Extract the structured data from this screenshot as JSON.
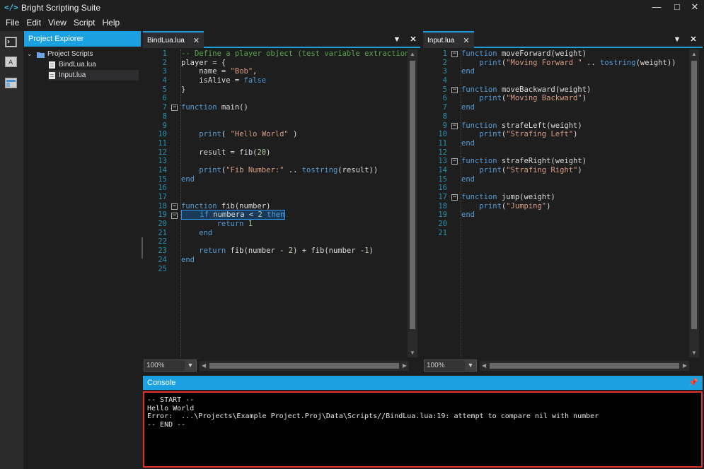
{
  "window": {
    "title": "Bright Scripting Suite",
    "icon": "code-brackets-icon",
    "controls": [
      "minimize",
      "maximize",
      "close"
    ]
  },
  "menu": [
    "File",
    "Edit",
    "View",
    "Script",
    "Help"
  ],
  "toolstrip": [
    "console-tool-icon",
    "text-tool-icon",
    "layout-tool-icon"
  ],
  "explorer": {
    "title": "Project Explorer",
    "folder": "Project Scripts",
    "files": [
      "BindLua.lua",
      "Input.lua"
    ]
  },
  "left_editor": {
    "tab": "BindLua.lua",
    "zoom": "100%",
    "line_numbers": [
      "1",
      "2",
      "3",
      "4",
      "5",
      "6",
      "7",
      "8",
      "9",
      "10",
      "11",
      "12",
      "13",
      "14",
      "15",
      "16",
      "17",
      "18",
      "19",
      "20",
      "21",
      "22",
      "23",
      "24",
      "25"
    ],
    "lines": [
      [
        [
          "cm",
          "-- Define a player object (test variable extraction)"
        ]
      ],
      [
        [
          "",
          "player = {"
        ]
      ],
      [
        [
          "",
          "    name = "
        ],
        [
          "str",
          "\"Bob\""
        ],
        [
          "",
          ","
        ]
      ],
      [
        [
          "",
          "    isAlive = "
        ],
        [
          "kw",
          "false"
        ]
      ],
      [
        [
          "",
          "}"
        ]
      ],
      [],
      [
        [
          "kw",
          "function"
        ],
        [
          "",
          " main()"
        ]
      ],
      [],
      [],
      [
        [
          "",
          ""
        ],
        [
          "kw",
          "    print"
        ],
        [
          "",
          "( "
        ],
        [
          "str",
          "\"Hello World\""
        ],
        [
          "",
          " )"
        ]
      ],
      [],
      [
        [
          "",
          "    result = fib("
        ],
        [
          "num",
          "20"
        ],
        [
          "",
          ")"
        ]
      ],
      [],
      [
        [
          "kw",
          "    print"
        ],
        [
          "",
          "("
        ],
        [
          "str",
          "\"Fib Number:\""
        ],
        [
          "",
          " .. "
        ],
        [
          "kw",
          "tostring"
        ],
        [
          "",
          "(result))"
        ]
      ],
      [
        [
          "kw",
          "end"
        ]
      ],
      [],
      [],
      [
        [
          "kw",
          "function"
        ],
        [
          "",
          " fib(number)"
        ]
      ],
      [
        [
          "kw",
          "    if"
        ],
        [
          "",
          " numbera < "
        ],
        [
          "num",
          "2"
        ],
        [
          "kw",
          " then"
        ]
      ],
      [
        [
          "kw",
          "        return"
        ],
        [
          "",
          " "
        ],
        [
          "num",
          "1"
        ]
      ],
      [
        [
          "kw",
          "    end"
        ]
      ],
      [],
      [
        [
          "kw",
          "    return"
        ],
        [
          "",
          " fib(number - "
        ],
        [
          "num",
          "2"
        ],
        [
          "",
          ") + fib(number -"
        ],
        [
          "num",
          "1"
        ],
        [
          "",
          ")"
        ]
      ],
      [
        [
          "kw",
          "end"
        ]
      ],
      []
    ],
    "folds": [
      7,
      18,
      19
    ]
  },
  "right_editor": {
    "tab": "Input.lua",
    "zoom": "100%",
    "line_numbers": [
      "1",
      "2",
      "3",
      "4",
      "5",
      "6",
      "7",
      "8",
      "9",
      "10",
      "11",
      "12",
      "13",
      "14",
      "15",
      "16",
      "17",
      "18",
      "19",
      "20",
      "21"
    ],
    "lines": [
      [
        [
          "kw",
          "function"
        ],
        [
          "",
          " moveForward(weight)"
        ]
      ],
      [
        [
          "kw",
          "    print"
        ],
        [
          "",
          "("
        ],
        [
          "str",
          "\"Moving Forward \""
        ],
        [
          "",
          " .. "
        ],
        [
          "kw",
          "tostring"
        ],
        [
          "",
          "(weight))"
        ]
      ],
      [
        [
          "kw",
          "end"
        ]
      ],
      [],
      [
        [
          "kw",
          "function"
        ],
        [
          "",
          " moveBackward(weight)"
        ]
      ],
      [
        [
          "kw",
          "    print"
        ],
        [
          "",
          "("
        ],
        [
          "str",
          "\"Moving Backward\""
        ],
        [
          "",
          ")"
        ]
      ],
      [
        [
          "kw",
          "end"
        ]
      ],
      [],
      [
        [
          "kw",
          "function"
        ],
        [
          "",
          " strafeLeft(weight)"
        ]
      ],
      [
        [
          "kw",
          "    print"
        ],
        [
          "",
          "("
        ],
        [
          "str",
          "\"Strafing Left\""
        ],
        [
          "",
          ")"
        ]
      ],
      [
        [
          "kw",
          "end"
        ]
      ],
      [],
      [
        [
          "kw",
          "function"
        ],
        [
          "",
          " strafeRight(weight)"
        ]
      ],
      [
        [
          "kw",
          "    print"
        ],
        [
          "",
          "("
        ],
        [
          "str",
          "\"Strafing Right\""
        ],
        [
          "",
          ")"
        ]
      ],
      [
        [
          "kw",
          "end"
        ]
      ],
      [],
      [
        [
          "kw",
          "function"
        ],
        [
          "",
          " jump(weight)"
        ]
      ],
      [
        [
          "kw",
          "    print"
        ],
        [
          "",
          "("
        ],
        [
          "str",
          "\"Jumping\""
        ],
        [
          "",
          ")"
        ]
      ],
      [
        [
          "kw",
          "end"
        ]
      ],
      [],
      []
    ],
    "folds": [
      1,
      5,
      9,
      13,
      17
    ]
  },
  "console": {
    "title": "Console",
    "lines": [
      "-- START --",
      "Hello World",
      "Error:  ...\\Projects\\Example Project.Proj\\Data\\Scripts//BindLua.lua:19: attempt to compare nil with number",
      "-- END --"
    ]
  },
  "colors": {
    "accent": "#1ba1e2",
    "keyword": "#569cd6",
    "string": "#d69d85",
    "comment": "#57a64a",
    "error_border": "#e03030"
  }
}
